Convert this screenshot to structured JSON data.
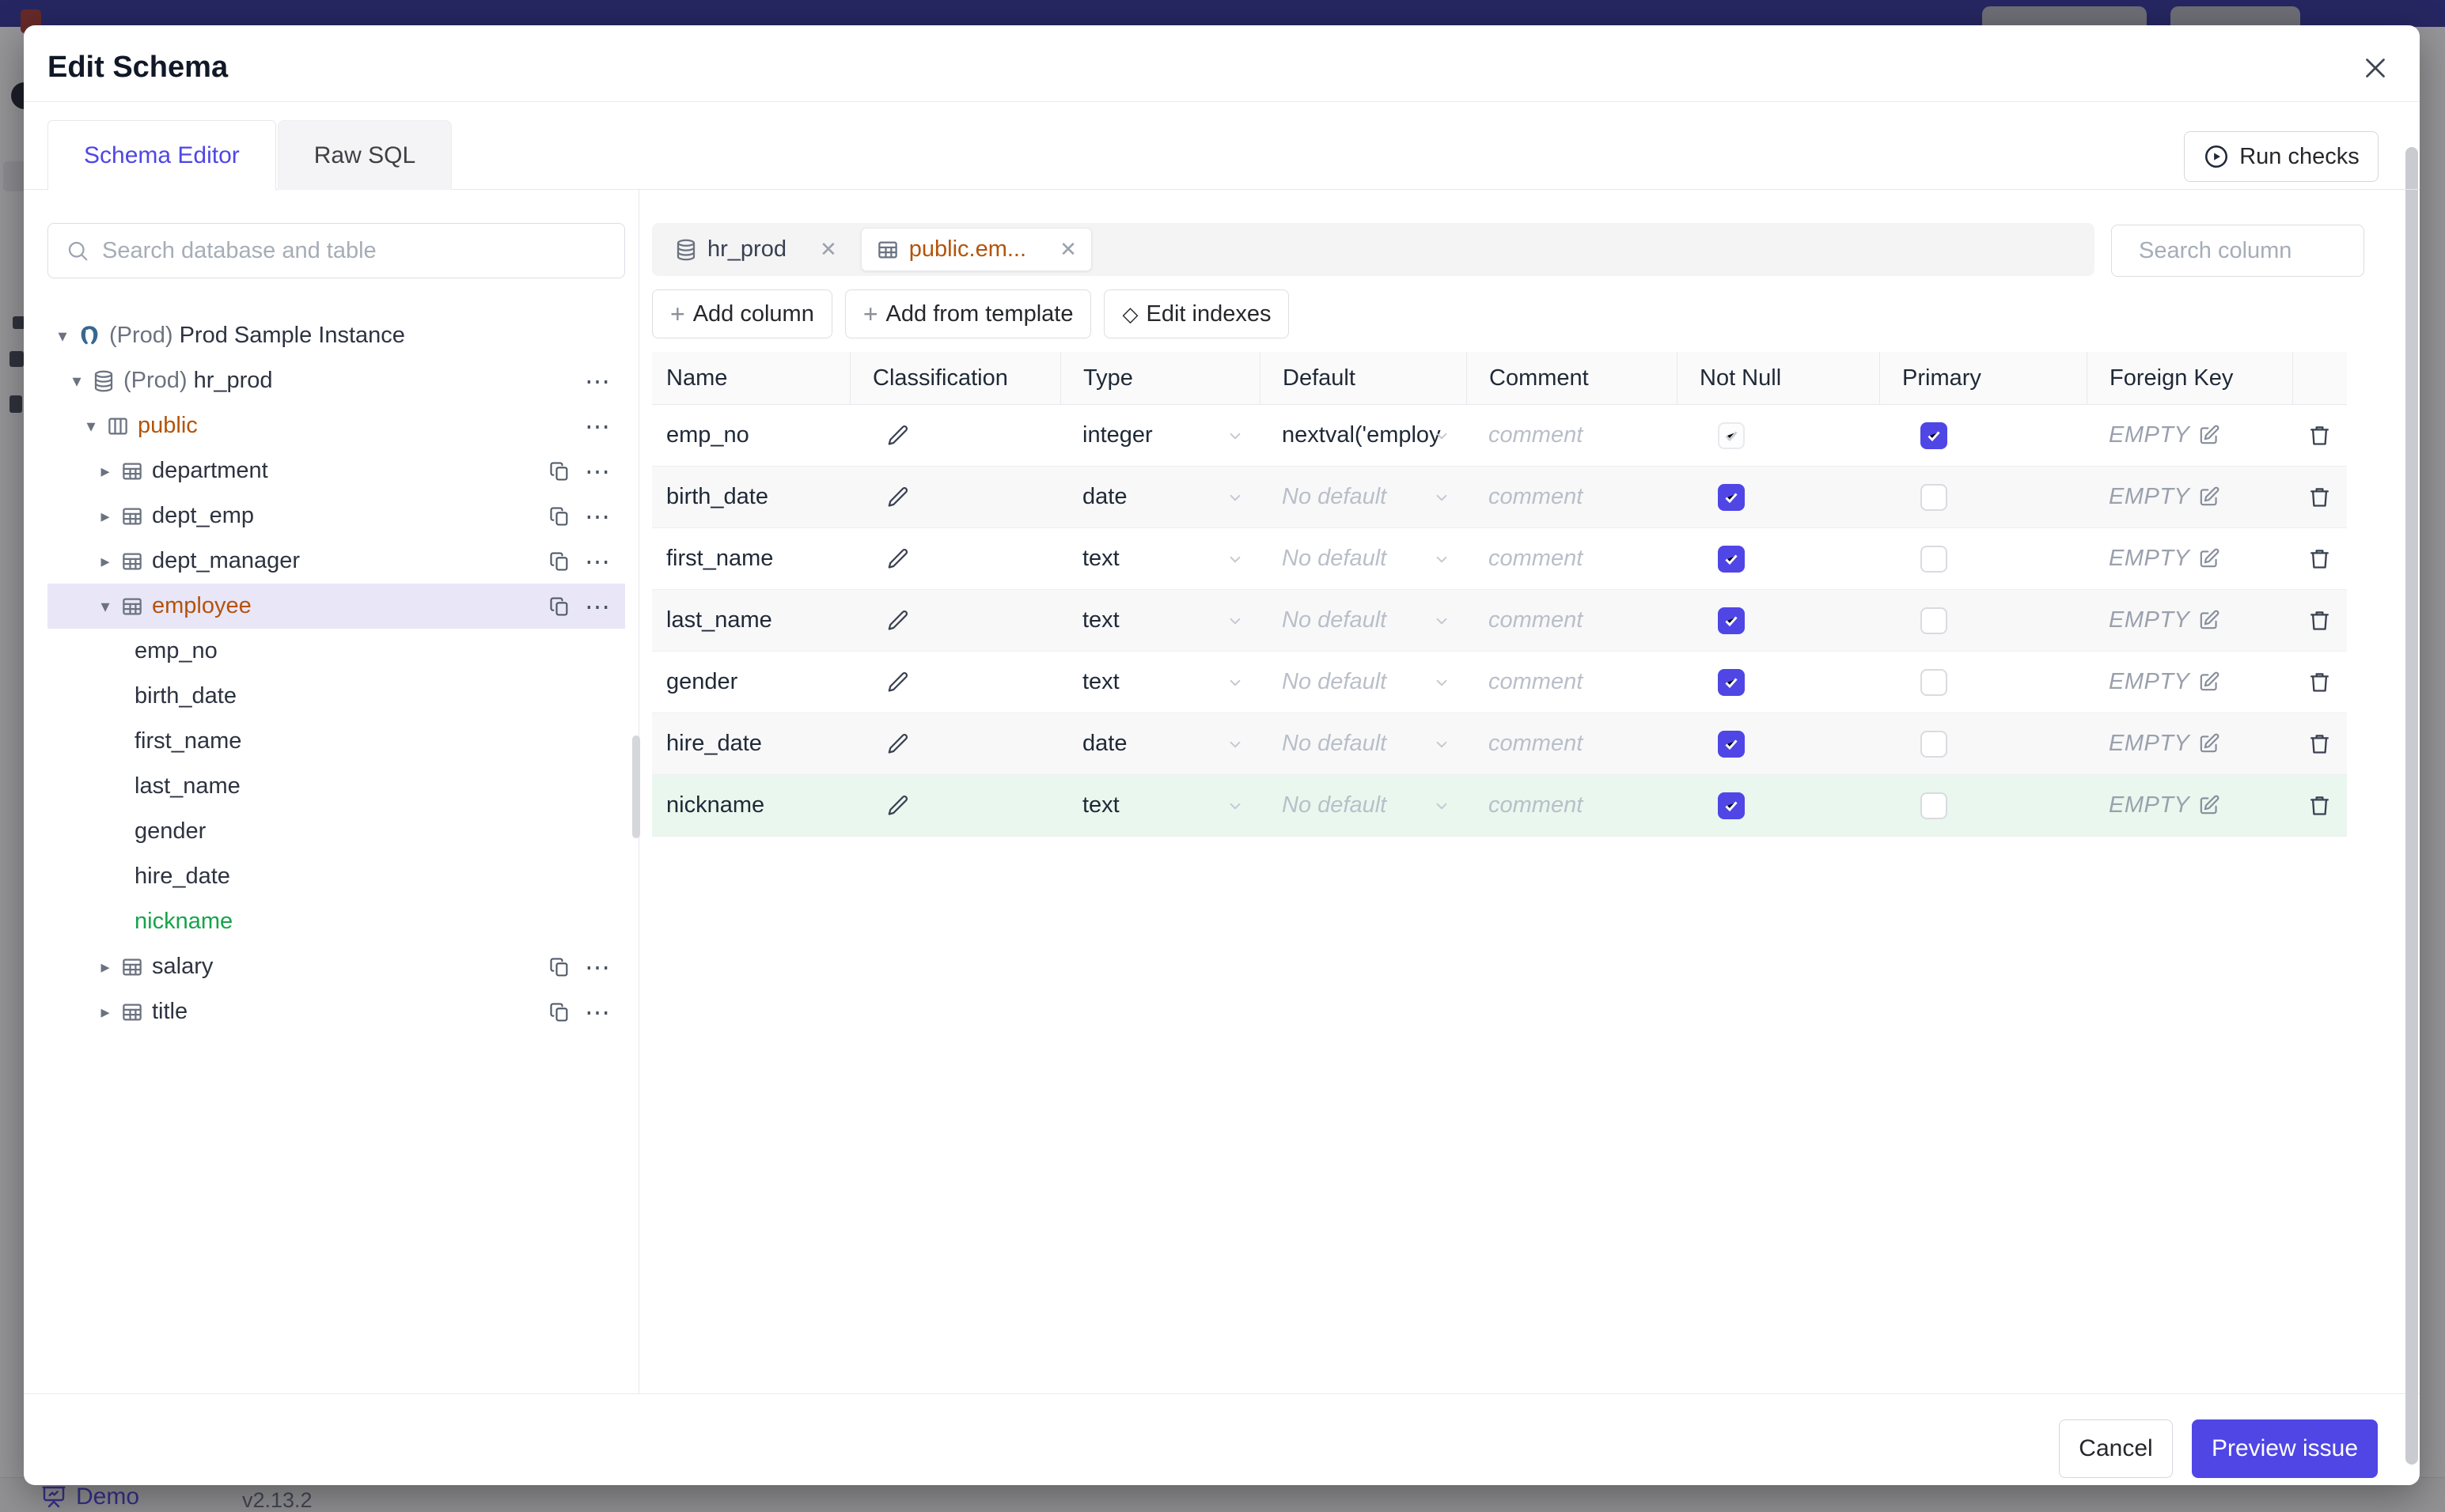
{
  "backdrop": {
    "brand_color": "#34349b",
    "demo_label": "Demo",
    "version": "v2.13.2"
  },
  "modal": {
    "title": "Edit Schema",
    "accent_color": "#4f46e5",
    "tabs": [
      {
        "label": "Schema Editor",
        "active": true
      },
      {
        "label": "Raw SQL",
        "active": false
      }
    ],
    "run_checks_label": "Run checks",
    "sidebar": {
      "search_placeholder": "Search database and table",
      "tree": [
        {
          "level": 0,
          "caret": "down",
          "icon": "postgres",
          "prefix": "(Prod)",
          "label": "Prod Sample Instance"
        },
        {
          "level": 1,
          "caret": "down",
          "icon": "database",
          "prefix": "(Prod)",
          "label": "hr_prod",
          "dots": true
        },
        {
          "level": 2,
          "caret": "down",
          "icon": "schema",
          "label": "public",
          "color": "orange",
          "dots": true
        },
        {
          "level": 3,
          "caret": "right",
          "icon": "table",
          "label": "department",
          "copy": true,
          "dots": true
        },
        {
          "level": 3,
          "caret": "right",
          "icon": "table",
          "label": "dept_emp",
          "copy": true,
          "dots": true
        },
        {
          "level": 3,
          "caret": "right",
          "icon": "table",
          "label": "dept_manager",
          "copy": true,
          "dots": true
        },
        {
          "level": 3,
          "caret": "down",
          "icon": "table",
          "label": "employee",
          "color": "orange",
          "copy": true,
          "dots": true,
          "selected": true
        },
        {
          "level": 4,
          "label": "emp_no"
        },
        {
          "level": 4,
          "label": "birth_date"
        },
        {
          "level": 4,
          "label": "first_name"
        },
        {
          "level": 4,
          "label": "last_name"
        },
        {
          "level": 4,
          "label": "gender"
        },
        {
          "level": 4,
          "label": "hire_date"
        },
        {
          "level": 4,
          "label": "nickname",
          "color": "green"
        },
        {
          "level": 3,
          "caret": "right",
          "icon": "table",
          "label": "salary",
          "copy": true,
          "dots": true
        },
        {
          "level": 3,
          "caret": "right",
          "icon": "table",
          "label": "title",
          "copy": true,
          "dots": true
        }
      ]
    },
    "editor": {
      "chips": [
        {
          "icon": "database",
          "label": "hr_prod",
          "active": false
        },
        {
          "icon": "table",
          "label": "public.em...",
          "active": true
        }
      ],
      "column_search_placeholder": "Search column",
      "toolbar": [
        {
          "icon": "plus",
          "label": "Add column"
        },
        {
          "icon": "plus",
          "label": "Add from template"
        },
        {
          "icon": "diamond",
          "label": "Edit indexes"
        }
      ],
      "table": {
        "headers": [
          "Name",
          "Classification",
          "Type",
          "Default",
          "Comment",
          "Not Null",
          "Primary",
          "Foreign Key",
          ""
        ],
        "comment_placeholder": "comment",
        "foreign_key_label": "EMPTY",
        "rows": [
          {
            "name": "emp_no",
            "type": "integer",
            "default": "nextval('employ",
            "default_is_set": true,
            "not_null": "checked-disabled",
            "primary": true,
            "style": "plain"
          },
          {
            "name": "birth_date",
            "type": "date",
            "default": "No default",
            "default_is_set": false,
            "not_null": "checked",
            "primary": false,
            "style": "alt"
          },
          {
            "name": "first_name",
            "type": "text",
            "default": "No default",
            "default_is_set": false,
            "not_null": "checked",
            "primary": false,
            "style": "plain"
          },
          {
            "name": "last_name",
            "type": "text",
            "default": "No default",
            "default_is_set": false,
            "not_null": "checked",
            "primary": false,
            "style": "alt"
          },
          {
            "name": "gender",
            "type": "text",
            "default": "No default",
            "default_is_set": false,
            "not_null": "checked",
            "primary": false,
            "style": "plain"
          },
          {
            "name": "hire_date",
            "type": "date",
            "default": "No default",
            "default_is_set": false,
            "not_null": "checked",
            "primary": false,
            "style": "alt"
          },
          {
            "name": "nickname",
            "type": "text",
            "default": "No default",
            "default_is_set": false,
            "not_null": "checked",
            "primary": false,
            "style": "new"
          }
        ]
      }
    },
    "footer": {
      "cancel_label": "Cancel",
      "primary_label": "Preview issue"
    }
  }
}
